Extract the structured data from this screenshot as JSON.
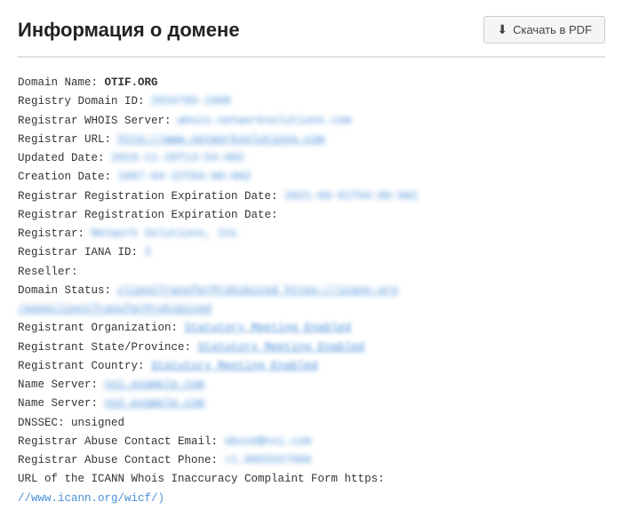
{
  "header": {
    "title": "Информация о домене",
    "pdf_button_label": "Скачать в PDF",
    "pdf_icon": "↓"
  },
  "whois": {
    "domain_name_label": "Domain Name:",
    "domain_name_value": "OTIF.ORG",
    "registry_id_label": "Registry Domain ID:",
    "registry_id_value": "2034765-1608",
    "registrar_whois_label": "Registrar WHOIS Server:",
    "registrar_whois_value": "whois.networksolutions.com",
    "registrar_url_label": "Registrar URL:",
    "registrar_url_value": "http://www.networksolutions.com",
    "updated_date_label": "Updated Date:",
    "updated_date_value": "2019-11-20T13:54:002",
    "creation_date_label": "Creation Date:",
    "creation_date_value": "1997-04-22T04:00:00Z",
    "expiration_date_label": "Registrar Registration Expiration Date:",
    "expiration_date_value": "2021-09-01T04:00:00Z",
    "expiration_date2_label": "Registrar Registration Expiration Date:",
    "expiration_date2_value": "",
    "registrar_label": "Registrar:",
    "registrar_value": "Network Solutions, Inc",
    "iana_label": "Registrar IANA ID:",
    "iana_value": "2",
    "reseller_label": "Reseller:",
    "reseller_value": "",
    "domain_status_label": "Domain Status:",
    "domain_status_value": "clientTransferProhibited https://icann.org",
    "domain_status_value2": "/epp#clientTransferProhibited",
    "registrant_org_label": "Registrant Organization:",
    "registrant_org_value": "Statutory Meeting Enabled",
    "registrant_state_label": "Registrant State/Province:",
    "registrant_state_value": "Statutory Meeting Enabled",
    "registrant_country_label": "Registrant Country:",
    "registrant_country_value": "Statutory Meeting Enabled",
    "ns1_label": "Name Server:",
    "ns1_value": "ns1.example.com",
    "ns2_label": "Name Server:",
    "ns2_value": "ns2.example.com",
    "dnssec_label": "DNSSEC:",
    "dnssec_value": "unsigned",
    "abuse_email_label": "Registrar Abuse Contact Email:",
    "abuse_email_value": "abuse@nsi.com",
    "abuse_phone_label": "Registrar Abuse Contact Phone:",
    "abuse_phone_value": "+1.8003337680",
    "icann_label": "URL of the ICANN Whois Inaccuracy Complaint Form https:",
    "icann_value": "//www.icann.org/wicf/)"
  }
}
